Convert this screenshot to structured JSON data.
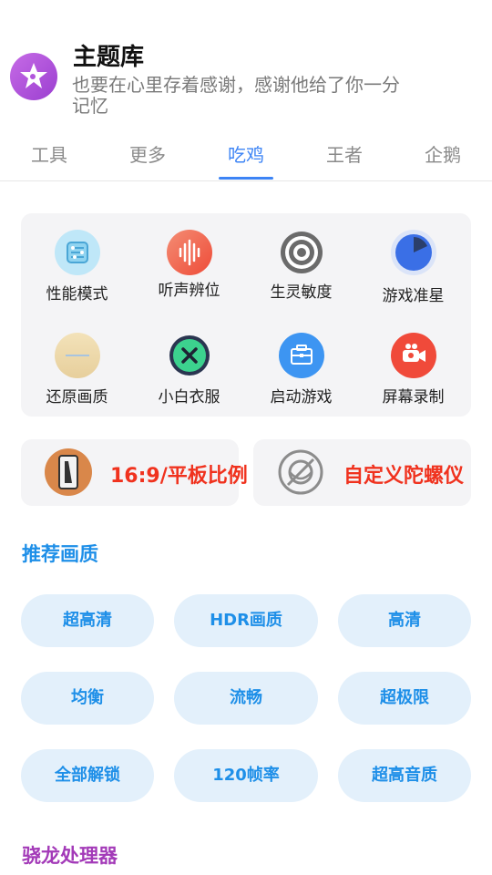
{
  "header": {
    "title": "主题库",
    "subtitle": "也要在心里存着感谢，感谢他给了你一分记忆",
    "logo_icon": "star-icon"
  },
  "tabs": [
    {
      "label": "工具",
      "active": false
    },
    {
      "label": "更多",
      "active": false
    },
    {
      "label": "吃鸡",
      "active": true
    },
    {
      "label": "王者",
      "active": false
    },
    {
      "label": "企鹅",
      "active": false
    }
  ],
  "tools": [
    {
      "label": "性能模式",
      "icon": "chip-icon",
      "color": "#8fd3f0"
    },
    {
      "label": "听声辨位",
      "icon": "sound-wave-icon",
      "color": "#f2674e"
    },
    {
      "label": "生灵敏度",
      "icon": "target-icon",
      "color": "#6b6b6b"
    },
    {
      "label": "游戏准星",
      "icon": "crosshair-pie-icon",
      "color": "#3a6fe6"
    },
    {
      "label": "还原画质",
      "icon": "restore-icon",
      "color": "#f0dcae"
    },
    {
      "label": "小白衣服",
      "icon": "close-circle-icon",
      "color": "#3cd28e"
    },
    {
      "label": "启动游戏",
      "icon": "briefcase-icon",
      "color": "#3d95f2"
    },
    {
      "label": "屏幕录制",
      "icon": "video-record-icon",
      "color": "#f04a3a"
    }
  ],
  "features": [
    {
      "label": "16:9/平板比例",
      "icon": "tablet-ratio-icon"
    },
    {
      "label": "自定义陀螺仪",
      "icon": "gyroscope-icon"
    }
  ],
  "sections": {
    "quality_title": "推荐画质",
    "quality_title_color": "#1e8fe8",
    "processor_title": "骁龙处理器",
    "processor_title_color": "#a33ab8"
  },
  "quality_options": [
    "超高清",
    "HDR画质",
    "高清",
    "均衡",
    "流畅",
    "超极限",
    "全部解锁",
    "120帧率",
    "超高音质"
  ],
  "colors": {
    "accent": "#3d84f5",
    "feature_text": "#f0321e",
    "pill_bg": "#e3f0fb",
    "pill_text": "#1e8fe8"
  }
}
